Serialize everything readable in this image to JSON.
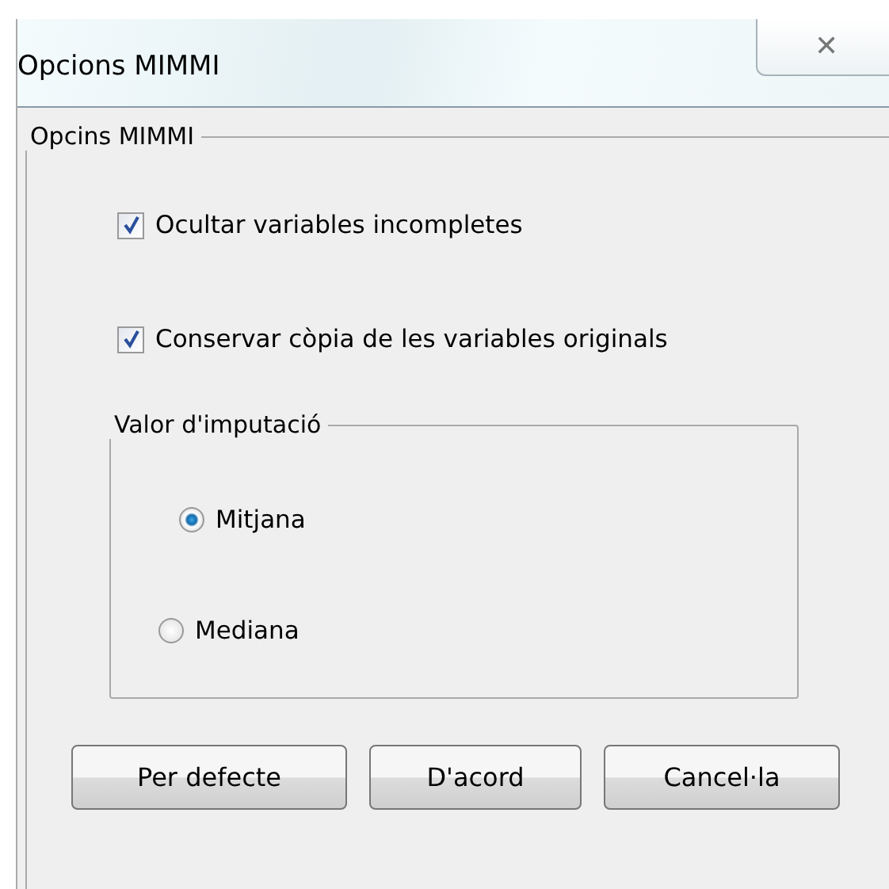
{
  "window": {
    "title": "Opcions MIMMI",
    "close": "✕"
  },
  "group": {
    "legend": "Opcins MIMMI"
  },
  "checkboxes": [
    {
      "label": "Ocultar variables incompletes",
      "checked": true
    },
    {
      "label": "Conservar còpia de les variables originals",
      "checked": true
    }
  ],
  "imputation": {
    "legend": "Valor d'imputació",
    "options": [
      {
        "label": "Mitjana",
        "selected": true
      },
      {
        "label": "Mediana",
        "selected": false
      }
    ]
  },
  "buttons": [
    "Per defecte",
    "D'acord",
    "Cancel·la"
  ]
}
